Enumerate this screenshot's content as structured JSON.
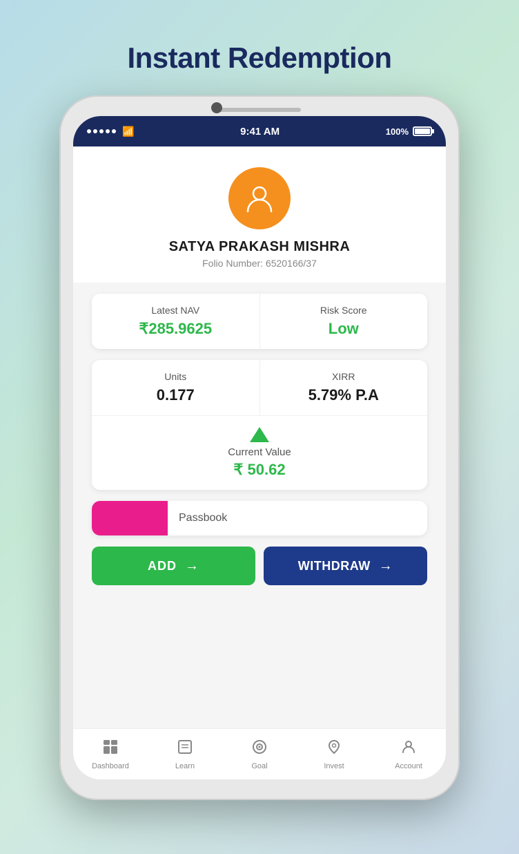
{
  "page": {
    "title": "Instant Redemption"
  },
  "statusBar": {
    "time": "9:41 AM",
    "battery": "100%"
  },
  "profile": {
    "name": "SATYA PRAKASH MISHRA",
    "folio_label": "Folio Number: 6520166/37"
  },
  "navRisk": {
    "nav_label": "Latest NAV",
    "nav_value": "₹285.9625",
    "risk_label": "Risk Score",
    "risk_value": "Low"
  },
  "unitsXirr": {
    "units_label": "Units",
    "units_value": "0.177",
    "xirr_label": "XIRR",
    "xirr_value": "5.79% P.A"
  },
  "currentValue": {
    "label": "Current Value",
    "amount": "₹ 50.62"
  },
  "passbook": {
    "label": "Passbook"
  },
  "buttons": {
    "add": "ADD",
    "withdraw": "WITHDRAW"
  },
  "bottomNav": {
    "items": [
      {
        "icon": "⊞",
        "label": "Dashboard"
      },
      {
        "icon": "◻",
        "label": "Learn"
      },
      {
        "icon": "◎",
        "label": "Goal"
      },
      {
        "icon": "🐷",
        "label": "Invest"
      },
      {
        "icon": "👤",
        "label": "Account"
      }
    ]
  }
}
